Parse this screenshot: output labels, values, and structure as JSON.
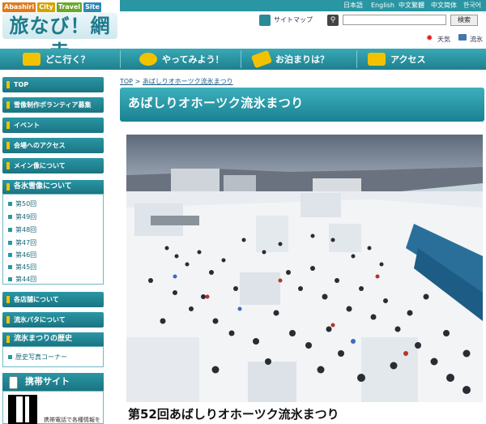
{
  "header": {
    "logo": {
      "ribbon": [
        {
          "text": "Abashiri",
          "color": "#e07a1a"
        },
        {
          "text": "City",
          "color": "#d4a300"
        },
        {
          "text": "Travel",
          "color": "#6aa82a"
        },
        {
          "text": "Site",
          "color": "#2a8ab8"
        }
      ],
      "title": "旅なび！網走"
    },
    "languages": [
      "日本語",
      "English",
      "中文繁體",
      "中文简体",
      "한국어"
    ],
    "sitemap_label": "サイトマップ",
    "search_placeholder": "",
    "search_button": "検索",
    "weather_label": "天気",
    "snow_label": "流氷"
  },
  "global_nav": [
    {
      "label": "どこ行く？",
      "icon": "camera-icon"
    },
    {
      "label": "やってみよう！",
      "icon": "person-icon"
    },
    {
      "label": "お泊まりは？",
      "icon": "key-icon"
    },
    {
      "label": "アクセス",
      "icon": "car-icon"
    }
  ],
  "sidebar": {
    "items_top": [
      "TOP",
      "雪像制作ボランティア募集",
      "イベント",
      "会場へのアクセス",
      "メイン像について"
    ],
    "categories_header": "各氷雪像について",
    "categories": [
      "第50回",
      "第49回",
      "第48回",
      "第47回",
      "第46回",
      "第45回",
      "第44回"
    ],
    "items_mid": [
      "各店舗について",
      "流氷パタについて"
    ],
    "history_header": "流氷まつりの歴史",
    "history_link": "歴史写真コーナー",
    "mobile_header": "携帯サイト",
    "mobile_text": "携帯電話で各種情報を"
  },
  "main": {
    "breadcrumb_top": "TOP",
    "breadcrumb_sep": ">",
    "breadcrumb_current": "あばしりオホーツク流氷まつり",
    "title": "あばしりオホーツク流氷まつり",
    "caption": "第52回あばしりオホーツク流氷まつり"
  }
}
